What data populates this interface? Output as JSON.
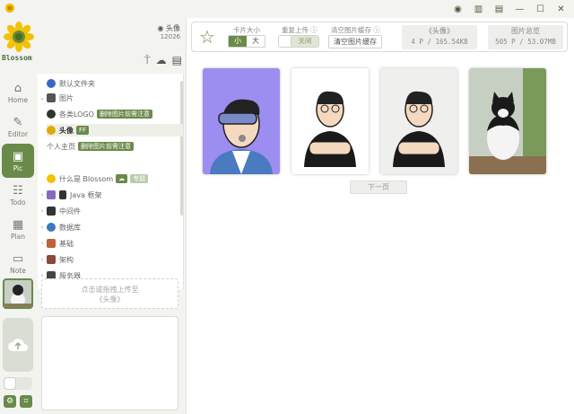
{
  "app": {
    "name": "Blossom"
  },
  "colors": {
    "accent": "#6a8a4a",
    "accent_light": "#b9ccaa"
  },
  "nav": {
    "items": [
      {
        "label": "Home",
        "icon": "home-icon"
      },
      {
        "label": "Editor",
        "icon": "pen-icon"
      },
      {
        "label": "Pic",
        "icon": "image-icon",
        "active": true
      },
      {
        "label": "Todo",
        "icon": "todo-icon"
      },
      {
        "label": "Plan",
        "icon": "calendar-icon"
      },
      {
        "label": "Note",
        "icon": "ticket-icon"
      }
    ]
  },
  "user": {
    "name": "头像",
    "code": "12026"
  },
  "tree": {
    "items": [
      {
        "label": "默认文件夹",
        "tag": ""
      },
      {
        "label": "图片",
        "tag": ""
      },
      {
        "label": "各类LOGO",
        "tag": "删除图片前需注意"
      },
      {
        "label": "头像",
        "tag": "FF"
      },
      {
        "label": "个人主页",
        "tag": "删除图片前需注意"
      },
      {
        "label": "什么是 Blossom",
        "tag": "专题"
      },
      {
        "label": "Java 框架",
        "tag": ""
      },
      {
        "label": "中间件",
        "tag": ""
      },
      {
        "label": "数据库",
        "tag": ""
      },
      {
        "label": "基础",
        "tag": ""
      },
      {
        "label": "架构",
        "tag": ""
      },
      {
        "label": "服务器",
        "tag": ""
      }
    ]
  },
  "upload": {
    "hint": "点击或拖拽上传至",
    "target": "《头像》"
  },
  "toolbar": {
    "card_size_label": "卡片大小",
    "size_small": "小",
    "size_large": "大",
    "reupload_label": "重复上传 ⓘ",
    "reupload_value": "关闭",
    "clear_cache_label": "清空图片缓存 ⓘ",
    "clear_cache_button": "清空图片缓存",
    "folder_title": "《头像》",
    "folder_stats": "4 P / 165.54KB",
    "total_title": "图片总览",
    "total_stats": "505 P / 53.07MB"
  },
  "pager": {
    "next_label": "下一页"
  }
}
